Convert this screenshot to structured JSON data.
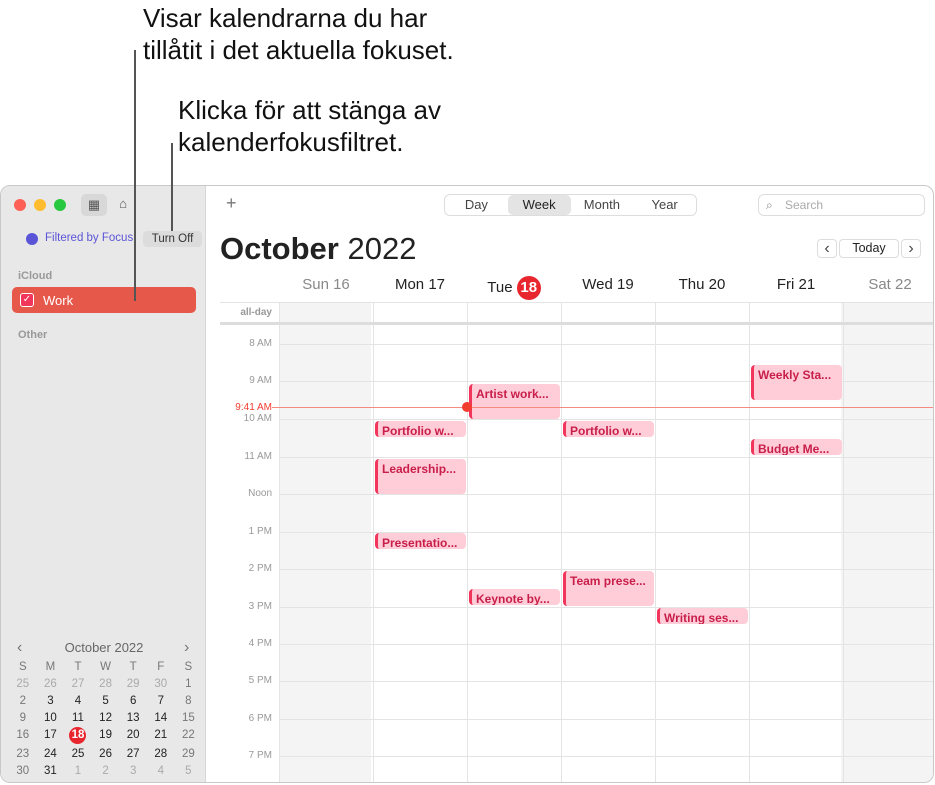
{
  "callouts": [
    "Visar kalendrarna du har tillåtit i det aktuella fokuset.",
    "Klicka för att stänga av kalenderfokusfiltret."
  ],
  "callout_lines": [
    [
      "Visar kalendrarna du har",
      "tillåtit i det aktuella fokuset."
    ],
    [
      "Klicka för att stänga av",
      "kalenderfokusfiltret."
    ]
  ],
  "sidebar": {
    "filter_label": "Filtered by Focus",
    "turn_off": "Turn Off",
    "groups": [
      {
        "title": "iCloud",
        "items": [
          {
            "label": "Work",
            "checked": true,
            "color": "#e5584a"
          }
        ]
      },
      {
        "title": "Other",
        "items": []
      }
    ]
  },
  "mini_cal": {
    "title": "October 2022",
    "weekdays": [
      "S",
      "M",
      "T",
      "W",
      "T",
      "F",
      "S"
    ],
    "weeks": [
      [
        "25",
        "26",
        "27",
        "28",
        "29",
        "30",
        "1"
      ],
      [
        "2",
        "3",
        "4",
        "5",
        "6",
        "7",
        "8"
      ],
      [
        "9",
        "10",
        "11",
        "12",
        "13",
        "14",
        "15"
      ],
      [
        "16",
        "17",
        "18",
        "19",
        "20",
        "21",
        "22"
      ],
      [
        "23",
        "24",
        "25",
        "26",
        "27",
        "28",
        "29"
      ],
      [
        "30",
        "31",
        "1",
        "2",
        "3",
        "4",
        "5"
      ]
    ],
    "today": "18"
  },
  "toolbar": {
    "views": [
      "Day",
      "Week",
      "Month",
      "Year"
    ],
    "selected": "Week",
    "search_placeholder": "Search",
    "today": "Today"
  },
  "header": {
    "month": "October",
    "year": "2022"
  },
  "days": [
    {
      "name": "Sun",
      "num": "16"
    },
    {
      "name": "Mon",
      "num": "17"
    },
    {
      "name": "Tue",
      "num": "18",
      "today": true
    },
    {
      "name": "Wed",
      "num": "19"
    },
    {
      "name": "Thu",
      "num": "20"
    },
    {
      "name": "Fri",
      "num": "21"
    },
    {
      "name": "Sat",
      "num": "22"
    }
  ],
  "allday": "all-day",
  "hours": [
    "8 AM",
    "9 AM",
    "10 AM",
    "11 AM",
    "Noon",
    "1 PM",
    "2 PM",
    "3 PM",
    "4 PM",
    "5 PM",
    "6 PM",
    "7 PM"
  ],
  "now": "9:41 AM",
  "events": [
    {
      "title": "Artist work...",
      "day": "Tue"
    },
    {
      "title": "Weekly Sta...",
      "day": "Fri"
    },
    {
      "title": "Portfolio w...",
      "day": "Mon"
    },
    {
      "title": "Portfolio w...",
      "day": "Wed"
    },
    {
      "title": "Budget Me...",
      "day": "Fri"
    },
    {
      "title": "Leadership...",
      "day": "Mon"
    },
    {
      "title": "Presentatio...",
      "day": "Mon"
    },
    {
      "title": "Team prese...",
      "day": "Wed"
    },
    {
      "title": "Keynote by...",
      "day": "Tue"
    },
    {
      "title": "Writing ses...",
      "day": "Thu"
    }
  ],
  "colors": {
    "accent": "#f2355b",
    "today": "#e8262e",
    "work": "#e5584a"
  }
}
